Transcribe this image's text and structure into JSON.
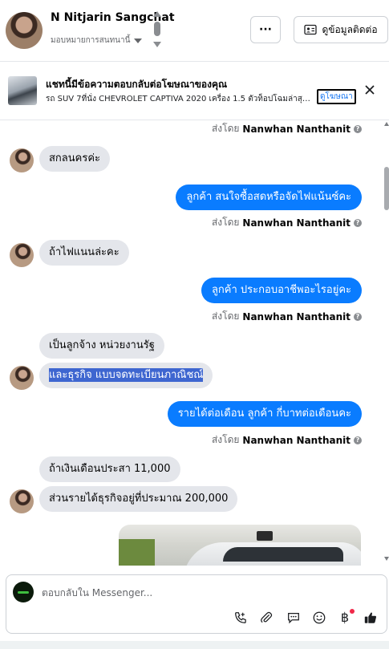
{
  "header": {
    "name": "N Nitjarin Sangchat",
    "assign_label": "มอบหมายการสนทนานี้",
    "more_label": "···",
    "contact_label": "ดูข้อมูลติดต่อ"
  },
  "ad": {
    "title": "แชทนี้มีข้อความตอบกลับต่อโฆษณาของคุณ",
    "subtitle": "รถ SUV 7ที่นั่ง CHEVROLET CAPTIVA 2020 เครื่อง 1.5 ตัวท็อปโฉมล่าสุด ...",
    "link_label": "ดูโฆษณา"
  },
  "messages": {
    "sent_by_prefix": "ส่งโดย",
    "sender": "Nanwhan Nanthanit",
    "m1": "สกลนครค่ะ",
    "m2": "ลูกค้า สนใจซื้อสดหรือจัดไฟแน้นซ์คะ",
    "m3": "ถ้าไฟแนนล่ะคะ",
    "m4": "ลูกค้า ประกอบอาชีพอะไรอยู่คะ",
    "m5": "เป็นลูกจ้าง หน่วยงานรัฐ",
    "m6": "และธุรกิจ แบบจดทะเบียนภาณิชณ์",
    "m7": "รายได้ต่อเดือน  ลูกค้า กี่บาทต่อเดือนคะ",
    "m8": "ถ้าเงินเดือนประสา 11,000",
    "m9": "ส่วนรายได้ธุรกิจอยู่ที่ประมาณ 200,000"
  },
  "composer": {
    "placeholder": "ตอบกลับใน Messenger..."
  },
  "icons": {
    "tools": [
      "call-icon",
      "attach-icon",
      "quick-reply-icon",
      "emoji-icon",
      "baht-icon",
      "like-icon"
    ]
  },
  "colors": {
    "sent_bubble": "#0a7cff",
    "received_bubble": "#e4e6eb",
    "selection": "#3e66d0"
  }
}
